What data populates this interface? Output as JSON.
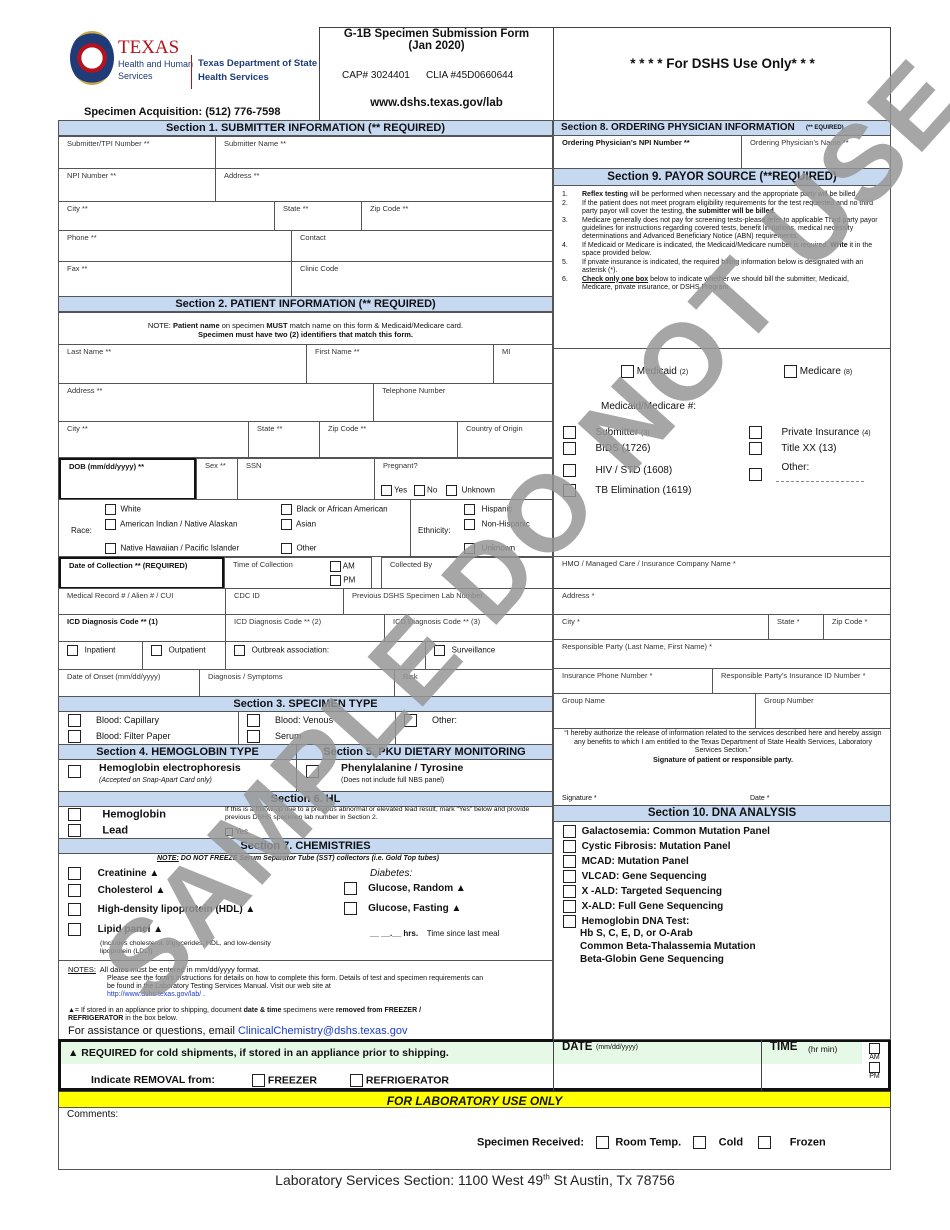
{
  "header": {
    "logo": {
      "texas": "TEXAS",
      "hhs_line1": "Health and Human",
      "hhs_line2": "Services",
      "dshs_line1": "Texas Department of State",
      "dshs_line2": "Health Services"
    },
    "specimen_acquisition": "Specimen Acquisition:  (512) 776-7598",
    "form_title": "G-1B Specimen Submission Form",
    "form_date": "(Jan 2020)",
    "cap": "CAP# 3024401",
    "clia": "CLIA #45D0660644",
    "website": "www.dshs.texas.gov/lab",
    "dshs_use_only": "* * * * For DSHS Use Only* * *"
  },
  "section1": {
    "title": "Section 1.  SUBMITTER INFORMATION  (** REQUIRED)",
    "fields": {
      "tpi": "Submitter/TPI Number **",
      "name": "Submitter Name **",
      "npi": "NPI Number **",
      "address": "Address **",
      "city": "City **",
      "state": "State **",
      "zip": "Zip Code **",
      "phone": "Phone **",
      "contact": "Contact",
      "fax": "Fax **",
      "clinic": "Clinic Code"
    }
  },
  "section2": {
    "title": "Section 2.  PATIENT INFORMATION (** REQUIRED)",
    "note_prefix": "NOTE:  ",
    "note_b1": "Patient name",
    "note_t1": " on specimen ",
    "note_b2": "MUST",
    "note_t2": " match name on this form & Medicaid/Medicare card.",
    "note_line2": "Specimen must have two (2) identifiers that match this form.",
    "fields": {
      "last": "Last Name **",
      "first": "First Name **",
      "mi": "MI",
      "address": "Address **",
      "telephone": "Telephone Number",
      "city": "City **",
      "state": "State **",
      "zip": "Zip Code **",
      "country": "Country of Origin",
      "dob": "DOB (mm/dd/yyyy) **",
      "sex": "Sex **",
      "ssn": "SSN",
      "pregnant": "Pregnant?",
      "collection_date": "Date of Collection ** (REQUIRED)",
      "collection_time": "Time of Collection",
      "collected_by": "Collected By",
      "mrn": "Medical Record # / Alien # / CUI",
      "cdc": "CDC ID",
      "prev_lab": "Previous DSHS Specimen Lab Number",
      "icd1": "ICD Diagnosis Code ** (1)",
      "icd2": "ICD Diagnosis Code ** (2)",
      "icd3": "ICD Diagnosis Code ** (3)",
      "onset": "Date of Onset (mm/dd/yyyy)",
      "diagnosis": "Diagnosis / Symptoms",
      "risk": "Risk"
    },
    "pregnant_options": [
      "Yes",
      "No",
      "Unknown"
    ],
    "race_label": "Race:",
    "race_options": [
      "White",
      "American Indian / Native Alaskan",
      "Native Hawaiian / Pacific Islander",
      "Black or African American",
      "Asian",
      "Other"
    ],
    "ethnicity_label": "Ethnicity:",
    "ethnicity_options": [
      "Hispanic",
      "Non-Hispanic",
      "Unknown"
    ],
    "ampm": [
      "AM",
      "PM"
    ],
    "patient_type": [
      "Inpatient",
      "Outpatient",
      "Outbreak association:",
      "Surveillance"
    ]
  },
  "section3": {
    "title": "Section 3.  SPECIMEN TYPE",
    "options": [
      "Blood:  Capillary",
      "Blood:  Filter Paper",
      "Blood:  Venous",
      "Serum",
      "Other:"
    ]
  },
  "section4": {
    "title": "Section 4.  HEMOGLOBIN TYPE",
    "option": "Hemoglobin electrophoresis",
    "note": "(Accepted on Snap-Apart Card only)"
  },
  "section5": {
    "title": "Section 5.  PKU DIETARY MONITORING",
    "option": "Phenylalanine / Tyrosine",
    "note": "(Does not include full NBS panel)"
  },
  "section6": {
    "title": "Section 6.  HL",
    "options": [
      "Hemoglobin",
      "Lead"
    ],
    "note": "If this is a follow-up due to a previous abnormal or elevated lead result, mark “Yes” below and provide previous DSHS specimen lab number in Section 2.",
    "yes": "Yes"
  },
  "section7": {
    "title": "Section 7.  CHEMISTRIES",
    "note_label": "NOTE:",
    "note": " DO NOT FREEZE Serum Separator Tube (SST) collectors (i.e. Gold Top tubes)",
    "left_options": [
      "Creatinine ▲",
      "Cholesterol ▲",
      "High-density lipoprotein (HDL) ▲",
      "Lipid panel ▲"
    ],
    "lipid_note": "(Includes cholesterol, triglycerides, HDL, and low-density lipoprotein (LDL))",
    "diabetes_label": "Diabetes:",
    "right_options": [
      "Glucose, Random ▲",
      "Glucose, Fasting ▲"
    ],
    "hrs_blank": "__ __.__ hrs.",
    "hrs_label": "Time since last meal"
  },
  "notes": {
    "label": "NOTES:",
    "line1": "All dates must be entered in mm/dd/yyyy format.",
    "line2": "Please see the form’s instructions for details on how to complete this form.  Details of test and specimen requirements can be found in the Laboratory Testing Services Manual. Visit our web site at",
    "link": "http://www.dshs.texas.gov/lab/",
    "triangle_note_a": "▲= If stored in an appliance prior to shipping, document ",
    "triangle_note_b": "date & time",
    "triangle_note_c": " specimens were ",
    "triangle_note_d": "removed from FREEZER / REFRIGERATOR",
    "triangle_note_e": " in the box below.",
    "assist": "For assistance or questions, email ",
    "email": "ClinicalChemistry@dshs.texas.gov"
  },
  "cold": {
    "required": "▲ REQUIRED for cold shipments, if stored in an appliance prior to shipping.",
    "indicate": "Indicate REMOVAL from:",
    "freezer": "FREEZER",
    "refrigerator": "REFRIGERATOR",
    "date_label": "DATE",
    "date_fmt": "(mm/dd/yyyy)",
    "time_label": "TIME",
    "time_fmt": "(hr min)",
    "am": "AM",
    "pm": "PM"
  },
  "section8": {
    "title": "Section 8.  ORDERING PHYSICIAN INFORMATION",
    "title_small": "(** EQUIRED)",
    "npi": "Ordering Physician’s NPI Number **",
    "name": "Ordering Physician’s Name **"
  },
  "section9": {
    "title": "Section 9.  PAYOR SOURCE (**REQUIRED)",
    "items": [
      {
        "n": "1.",
        "b": "Reflex testing",
        "t": " will be performed when necessary and the appropriate party will be billed."
      },
      {
        "n": "2.",
        "t": "If the patient does not meet program eligibility requirements for the test requested and no third party payor will cover the testing, ",
        "b2": "the submitter will be billed",
        "t2": "."
      },
      {
        "n": "3.",
        "t": "Medicare generally does not pay for screening tests-please refer to applicable Third party payor guidelines for instructions regarding covered tests, benefit limitations, medical necessity determinations and Advanced Beneficiary Notice (ABN) requirements."
      },
      {
        "n": "4.",
        "t": "If Medicaid or Medicare is indicated, the Medicaid/Medicare number is required.  ",
        "b2": "Write",
        "t2": " it in the space provided below."
      },
      {
        "n": "5.",
        "t": "If private insurance is indicated, the required billing information below is designated with an asterisk (*)."
      },
      {
        "n": "6.",
        "b": "Check only one box",
        "t": " below to indicate whether we should bill the submitter, Medicaid, Medicare, private insurance, or DSHS Program."
      }
    ],
    "medicaid": "Medicaid",
    "medicaid_code": "(2)",
    "medicare": "Medicare",
    "medicare_code": "(8)",
    "medicaid_number": "Medicaid/Medicare #:",
    "left_options": [
      {
        "label": "Submitter",
        "code": "(3)"
      },
      {
        "label": "BIDS (1726)",
        "code": ""
      },
      {
        "label": "HIV / STD (1608)",
        "code": ""
      },
      {
        "label": "TB Elimination (1619)",
        "code": ""
      }
    ],
    "right_options": [
      {
        "label": "Private Insurance",
        "code": "(4)"
      },
      {
        "label": "Title XX (13)",
        "code": ""
      },
      {
        "label": "Other:",
        "code": ""
      }
    ],
    "fields": {
      "hmo": "HMO / Managed Care / Insurance Company Name *",
      "address": "Address *",
      "city": "City *",
      "state": "State *",
      "zip": "Zip Code *",
      "responsible": "Responsible Party (Last Name, First Name) *",
      "ins_phone": "Insurance Phone Number *",
      "ins_id": "Responsible Party’s Insurance ID Number *",
      "group_name": "Group Name",
      "group_number": "Group Number"
    },
    "authorize": "“I hereby authorize the release of information related to the services described here and hereby assign any benefits to which I am entitled to the Texas Department of State Health Services, Laboratory Services Section.”",
    "signature_of": "Signature of patient or responsible party.",
    "signature": "Signature *",
    "date": "Date *"
  },
  "section10": {
    "title": "Section 10.  DNA ANALYSIS",
    "options": [
      "Galactosemia: Common Mutation Panel",
      "Cystic Fibrosis: Mutation Panel",
      "MCAD: Mutation Panel",
      "VLCAD: Gene Sequencing",
      "X -ALD: Targeted Sequencing",
      "X-ALD: Full Gene Sequencing",
      "Hemoglobin DNA Test:"
    ],
    "hb_sub": [
      "Hb S, C, E, D, or O-Arab",
      "Common Beta-Thalassemia Mutation",
      "Beta-Globin Gene Sequencing"
    ]
  },
  "lab": {
    "title": "FOR LABORATORY USE ONLY",
    "comments": "Comments:",
    "received": "Specimen Received:",
    "options": [
      "Room Temp.",
      "Cold",
      "Frozen"
    ]
  },
  "footer": {
    "address_a": "Laboratory Services Section: 1100 West 49",
    "address_sup": "th",
    "address_b": " St  Austin, Tx 78756"
  },
  "watermark": "SAMPLE DO NOT USE",
  "colors": {
    "section_blue": "#c6d9f1",
    "cold_green": "#e6f8e6",
    "lab_yellow": "#ffff00"
  }
}
